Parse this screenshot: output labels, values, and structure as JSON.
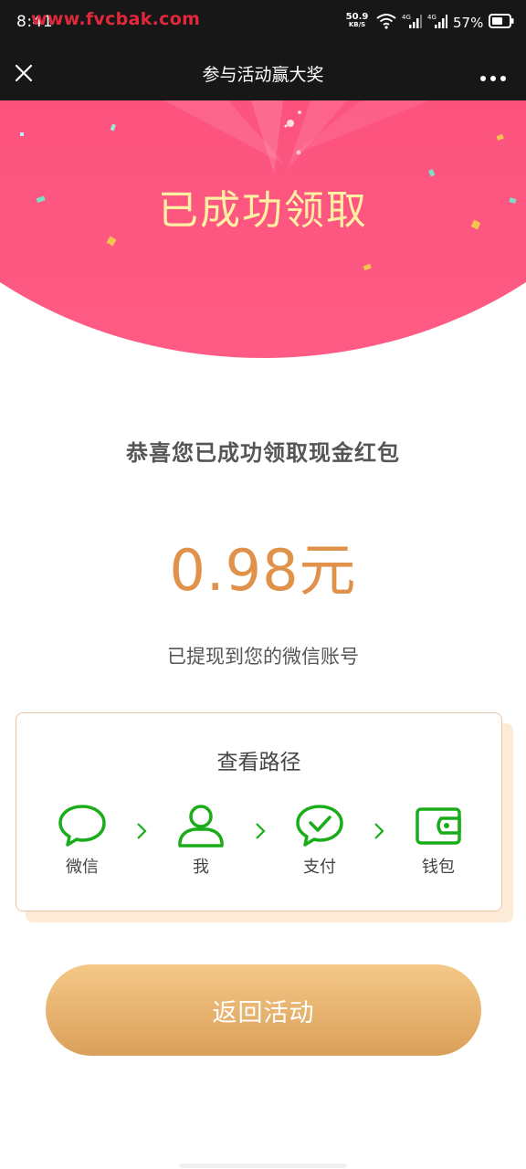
{
  "status_bar": {
    "time": "8:41",
    "watermark": "www.fvcbak.com",
    "net_speed": "50.9",
    "net_speed_unit": "KB/S",
    "battery": "57%",
    "icons": [
      "wifi-icon",
      "signal-4g-icon",
      "signal-4g-icon",
      "battery-icon"
    ]
  },
  "nav": {
    "title": "参与活动赢大奖",
    "close_icon": "close-icon",
    "more_icon": "more-icon"
  },
  "hero": {
    "title": "已成功领取",
    "colors": {
      "start": "#f54472",
      "end": "#ff5b84",
      "title": "#fff0a3"
    }
  },
  "main": {
    "congrats": "恭喜您已成功领取现金红包",
    "amount": "0.98元",
    "note": "已提现到您的微信账号"
  },
  "path_card": {
    "title": "查看路径",
    "steps": [
      {
        "label": "微信",
        "icon": "chat-bubble-icon"
      },
      {
        "label": "我",
        "icon": "user-icon"
      },
      {
        "label": "支付",
        "icon": "pay-check-icon"
      },
      {
        "label": "钱包",
        "icon": "wallet-icon"
      }
    ],
    "accent": "#1aad19"
  },
  "return_button": {
    "label": "返回活动",
    "colors": {
      "top": "#f5c887",
      "bottom": "#daa05a"
    }
  }
}
